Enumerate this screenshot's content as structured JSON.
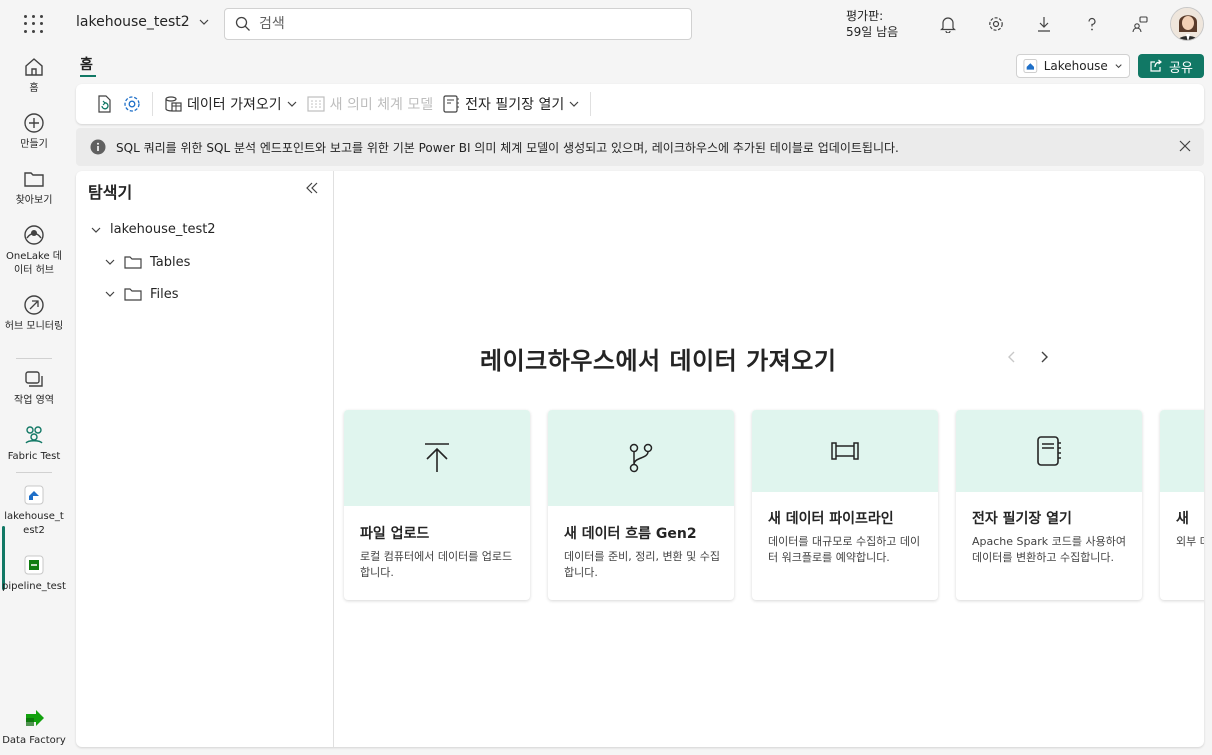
{
  "topbar": {
    "workspace_name": "lakehouse_test2",
    "search_placeholder": "검색",
    "trial_line1": "평가판:",
    "trial_line2": "59일 남음"
  },
  "rail": {
    "items": [
      {
        "label": "홈",
        "icon": "home-icon"
      },
      {
        "label": "만들기",
        "icon": "create-icon"
      },
      {
        "label": "찾아보기",
        "icon": "browse-icon"
      },
      {
        "label": "OneLake 데이터 허브",
        "icon": "onelake-icon"
      },
      {
        "label": "허브 모니터링",
        "icon": "monitor-icon"
      },
      {
        "label": "작업 영역",
        "icon": "workspaces-icon"
      },
      {
        "label": "Fabric Test",
        "icon": "fabric-test-icon"
      },
      {
        "label": "lakehouse_test2",
        "icon": "lakehouse-icon"
      },
      {
        "label": "pipeline_test",
        "icon": "pipeline-icon"
      },
      {
        "label": "Data Factory",
        "icon": "data-factory-icon"
      }
    ]
  },
  "tabs": {
    "home": "홈"
  },
  "header_actions": {
    "lakehouse_select": "Lakehouse",
    "share": "공유"
  },
  "ribbon": {
    "get_data": "데이터 가져오기",
    "new_semantic_model": "새 의미 체계 모델",
    "open_notebook": "전자 필기장 열기"
  },
  "info": {
    "message": "SQL 쿼리를 위한 SQL 분석 엔드포인트와 보고를 위한 기본 Power BI 의미 체계 모델이 생성되고 있으며, 레이크하우스에 추가된 테이블로 업데이트됩니다."
  },
  "explorer": {
    "title": "탐색기",
    "root": "lakehouse_test2",
    "folders": [
      "Tables",
      "Files"
    ]
  },
  "get_data": {
    "title": "레이크하우스에서 데이터 가져오기",
    "cards": [
      {
        "title": "파일 업로드",
        "desc": "로컬 컴퓨터에서 데이터를 업로드합니다.",
        "icon": "upload-icon"
      },
      {
        "title": "새 데이터 흐름 Gen2",
        "desc": "데이터를 준비, 정리, 변환 및 수집합니다.",
        "icon": "dataflow-icon"
      },
      {
        "title": "새 데이터 파이프라인",
        "desc": "데이터를 대규모로 수집하고 데이터 워크플로를 예약합니다.",
        "icon": "pipeline-card-icon"
      },
      {
        "title": "전자 필기장 열기",
        "desc": "Apache Spark 코드를 사용하여 데이터를 변환하고 수집합니다.",
        "icon": "notebook-icon"
      },
      {
        "title": "새",
        "desc": "외부 데이터에",
        "icon": "shortcut-icon"
      }
    ]
  },
  "colors": {
    "accent": "#117865",
    "card_top": "#e0f5ee"
  }
}
